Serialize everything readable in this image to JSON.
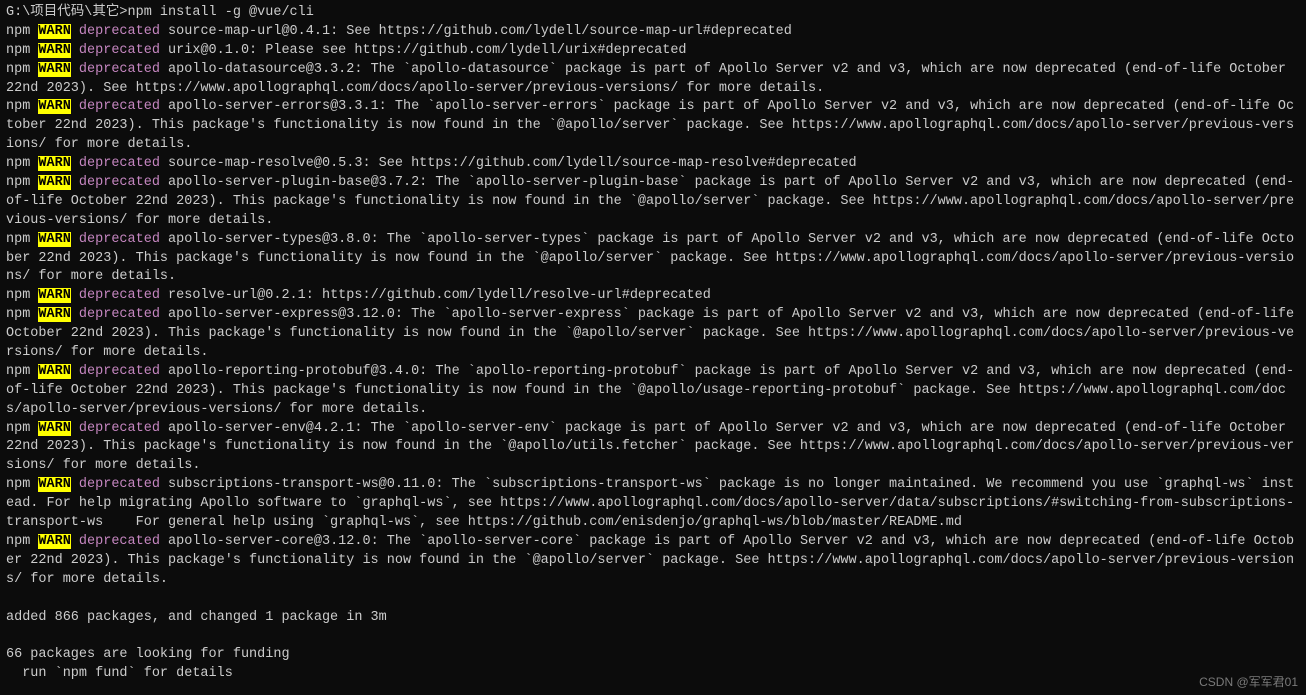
{
  "prompt": {
    "path": "G:\\项目代码\\其它>",
    "command": "npm install -g @vue/cli"
  },
  "lines": [
    {
      "prefix": "npm",
      "level": "WARN",
      "tag": "deprecated",
      "msg": "source-map-url@0.4.1: See https://github.com/lydell/source-map-url#deprecated"
    },
    {
      "prefix": "npm",
      "level": "WARN",
      "tag": "deprecated",
      "msg": "urix@0.1.0: Please see https://github.com/lydell/urix#deprecated"
    },
    {
      "prefix": "npm",
      "level": "WARN",
      "tag": "deprecated",
      "msg": "apollo-datasource@3.3.2: The `apollo-datasource` package is part of Apollo Server v2 and v3, which are now deprecated (end-of-life October 22nd 2023). See https://www.apollographql.com/docs/apollo-server/previous-versions/ for more details."
    },
    {
      "prefix": "npm",
      "level": "WARN",
      "tag": "deprecated",
      "msg": "apollo-server-errors@3.3.1: The `apollo-server-errors` package is part of Apollo Server v2 and v3, which are now deprecated (end-of-life October 22nd 2023). This package's functionality is now found in the `@apollo/server` package. See https://www.apollographql.com/docs/apollo-server/previous-versions/ for more details."
    },
    {
      "prefix": "npm",
      "level": "WARN",
      "tag": "deprecated",
      "msg": "source-map-resolve@0.5.3: See https://github.com/lydell/source-map-resolve#deprecated"
    },
    {
      "prefix": "npm",
      "level": "WARN",
      "tag": "deprecated",
      "msg": "apollo-server-plugin-base@3.7.2: The `apollo-server-plugin-base` package is part of Apollo Server v2 and v3, which are now deprecated (end-of-life October 22nd 2023). This package's functionality is now found in the `@apollo/server` package. See https://www.apollographql.com/docs/apollo-server/previous-versions/ for more details."
    },
    {
      "prefix": "npm",
      "level": "WARN",
      "tag": "deprecated",
      "msg": "apollo-server-types@3.8.0: The `apollo-server-types` package is part of Apollo Server v2 and v3, which are now deprecated (end-of-life October 22nd 2023). This package's functionality is now found in the `@apollo/server` package. See https://www.apollographql.com/docs/apollo-server/previous-versions/ for more details."
    },
    {
      "prefix": "npm",
      "level": "WARN",
      "tag": "deprecated",
      "msg": "resolve-url@0.2.1: https://github.com/lydell/resolve-url#deprecated"
    },
    {
      "prefix": "npm",
      "level": "WARN",
      "tag": "deprecated",
      "msg": "apollo-server-express@3.12.0: The `apollo-server-express` package is part of Apollo Server v2 and v3, which are now deprecated (end-of-life October 22nd 2023). This package's functionality is now found in the `@apollo/server` package. See https://www.apollographql.com/docs/apollo-server/previous-versions/ for more details."
    },
    {
      "prefix": "npm",
      "level": "WARN",
      "tag": "deprecated",
      "msg": "apollo-reporting-protobuf@3.4.0: The `apollo-reporting-protobuf` package is part of Apollo Server v2 and v3, which are now deprecated (end-of-life October 22nd 2023). This package's functionality is now found in the `@apollo/usage-reporting-protobuf` package. See https://www.apollographql.com/docs/apollo-server/previous-versions/ for more details."
    },
    {
      "prefix": "npm",
      "level": "WARN",
      "tag": "deprecated",
      "msg": "apollo-server-env@4.2.1: The `apollo-server-env` package is part of Apollo Server v2 and v3, which are now deprecated (end-of-life October 22nd 2023). This package's functionality is now found in the `@apollo/utils.fetcher` package. See https://www.apollographql.com/docs/apollo-server/previous-versions/ for more details."
    },
    {
      "prefix": "npm",
      "level": "WARN",
      "tag": "deprecated",
      "msg": "subscriptions-transport-ws@0.11.0: The `subscriptions-transport-ws` package is no longer maintained. We recommend you use `graphql-ws` instead. For help migrating Apollo software to `graphql-ws`, see https://www.apollographql.com/docs/apollo-server/data/subscriptions/#switching-from-subscriptions-transport-ws    For general help using `graphql-ws`, see https://github.com/enisdenjo/graphql-ws/blob/master/README.md"
    },
    {
      "prefix": "npm",
      "level": "WARN",
      "tag": "deprecated",
      "msg": "apollo-server-core@3.12.0: The `apollo-server-core` package is part of Apollo Server v2 and v3, which are now deprecated (end-of-life October 22nd 2023). This package's functionality is now found in the `@apollo/server` package. See https://www.apollographql.com/docs/apollo-server/previous-versions/ for more details."
    }
  ],
  "summary": {
    "added": "added 866 packages, and changed 1 package in 3m",
    "funding1": "66 packages are looking for funding",
    "funding2": "  run `npm fund` for details"
  },
  "watermark": "CSDN @军军君01"
}
